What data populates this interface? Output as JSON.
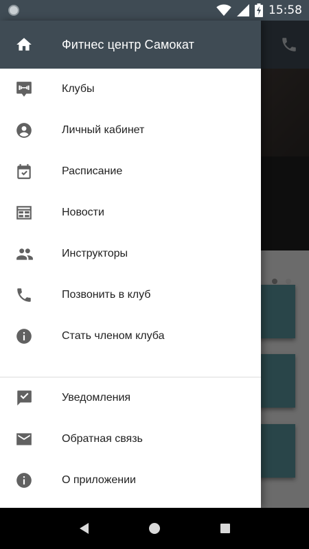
{
  "status_bar": {
    "time": "15:58",
    "icons": [
      "notification-dot-icon",
      "wifi-icon",
      "signal-icon",
      "battery-charging-icon"
    ]
  },
  "drawer": {
    "header": {
      "icon": "home-icon",
      "title": "Фитнес центр Самокат"
    },
    "items": [
      {
        "icon": "dumbbell-location-icon",
        "label": "Клубы"
      },
      {
        "icon": "account-circle-icon",
        "label": "Личный кабинет"
      },
      {
        "icon": "calendar-check-icon",
        "label": "Расписание"
      },
      {
        "icon": "newspaper-icon",
        "label": "Новости"
      },
      {
        "icon": "people-icon",
        "label": "Инструкторы"
      },
      {
        "icon": "phone-icon",
        "label": "Позвонить в клуб"
      },
      {
        "icon": "info-icon",
        "label": "Стать членом клуба"
      }
    ],
    "secondary_items": [
      {
        "icon": "notification-check-icon",
        "label": "Уведомления"
      },
      {
        "icon": "mail-icon",
        "label": "Обратная связь"
      },
      {
        "icon": "info-icon",
        "label": "О приложении"
      }
    ]
  },
  "background_app": {
    "header_icon": "phone-icon",
    "carousel_page": 3,
    "carousel_total": 3
  },
  "nav_bar": {
    "buttons": [
      "back-icon",
      "home-circle-icon",
      "recents-icon"
    ]
  },
  "colors": {
    "primary": "#3f4b54",
    "card": "#5c9aa2",
    "icon": "#616161"
  }
}
